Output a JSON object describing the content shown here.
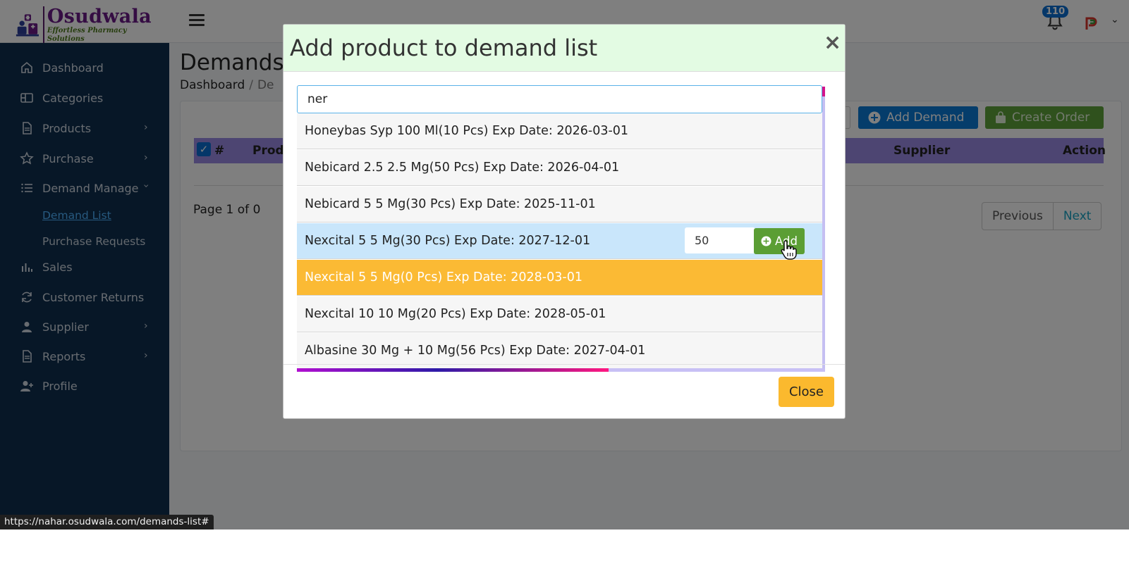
{
  "app": {
    "logo_title": "Osudwala",
    "logo_subtitle": "Effortless Pharmacy Solutions",
    "notification_count": "110"
  },
  "sidebar": {
    "items": [
      {
        "label": "Dashboard",
        "icon": "home-icon"
      },
      {
        "label": "Categories",
        "icon": "layout-icon"
      },
      {
        "label": "Products",
        "icon": "document-icon"
      },
      {
        "label": "Purchase",
        "icon": "star-icon"
      },
      {
        "label": "Demand Manage",
        "icon": "list-icon"
      },
      {
        "label": "Sales",
        "icon": "bar-chart-icon"
      },
      {
        "label": "Customer Returns",
        "icon": "refresh-icon"
      },
      {
        "label": "Supplier",
        "icon": "person-icon"
      },
      {
        "label": "Reports",
        "icon": "document-icon"
      },
      {
        "label": "Profile",
        "icon": "person-plus-icon"
      }
    ],
    "sub_items": [
      {
        "label": "Demand List",
        "active": true
      },
      {
        "label": "Purchase Requests",
        "active": false
      }
    ]
  },
  "page": {
    "title": "Demands",
    "breadcrumb_home": "Dashboard",
    "breadcrumb_current": "De",
    "add_demand_label": "Add Demand",
    "create_order_label": "Create Order",
    "columns": [
      "#",
      "Produ",
      "Supplier",
      "Action"
    ],
    "page_info": "Page 1 of 0",
    "previous_label": "Previous",
    "next_label": "Next"
  },
  "modal": {
    "title": "Add product to demand list",
    "close_x": "×",
    "search_value": "ner",
    "close_label": "Close",
    "add_label": "Add",
    "qty_value": "50",
    "results": [
      {
        "text": "Honeybas Syp 100 Ml(10 Pcs) Exp Date: 2026-03-01",
        "state": "normal"
      },
      {
        "text": "Nebicard 2.5 2.5 Mg(50 Pcs) Exp Date: 2026-04-01",
        "state": "normal"
      },
      {
        "text": "Nebicard 5 5 Mg(30 Pcs) Exp Date: 2025-11-01",
        "state": "normal"
      },
      {
        "text": "Nexcital 5 5 Mg(30 Pcs) Exp Date: 2027-12-01",
        "state": "selected"
      },
      {
        "text": "Nexcital 5 5 Mg(0 Pcs) Exp Date: 2028-03-01",
        "state": "warn"
      },
      {
        "text": "Nexcital 10 10 Mg(20 Pcs) Exp Date: 2028-05-01",
        "state": "normal"
      },
      {
        "text": "Albasine 30 Mg + 10 Mg(56 Pcs) Exp Date: 2027-04-01",
        "state": "normal"
      }
    ],
    "loading_progress_percent": 59
  },
  "status_url": "https://nahar.osudwala.com/demands-list#",
  "colors": {
    "sidebar_bg": "#0e2f4f",
    "header_green": "#e3fbe3",
    "selected_row": "#c9e6fb",
    "warn_row": "#fbba34",
    "add_green": "#5b9e34",
    "primary_blue": "#0b7bd6"
  }
}
